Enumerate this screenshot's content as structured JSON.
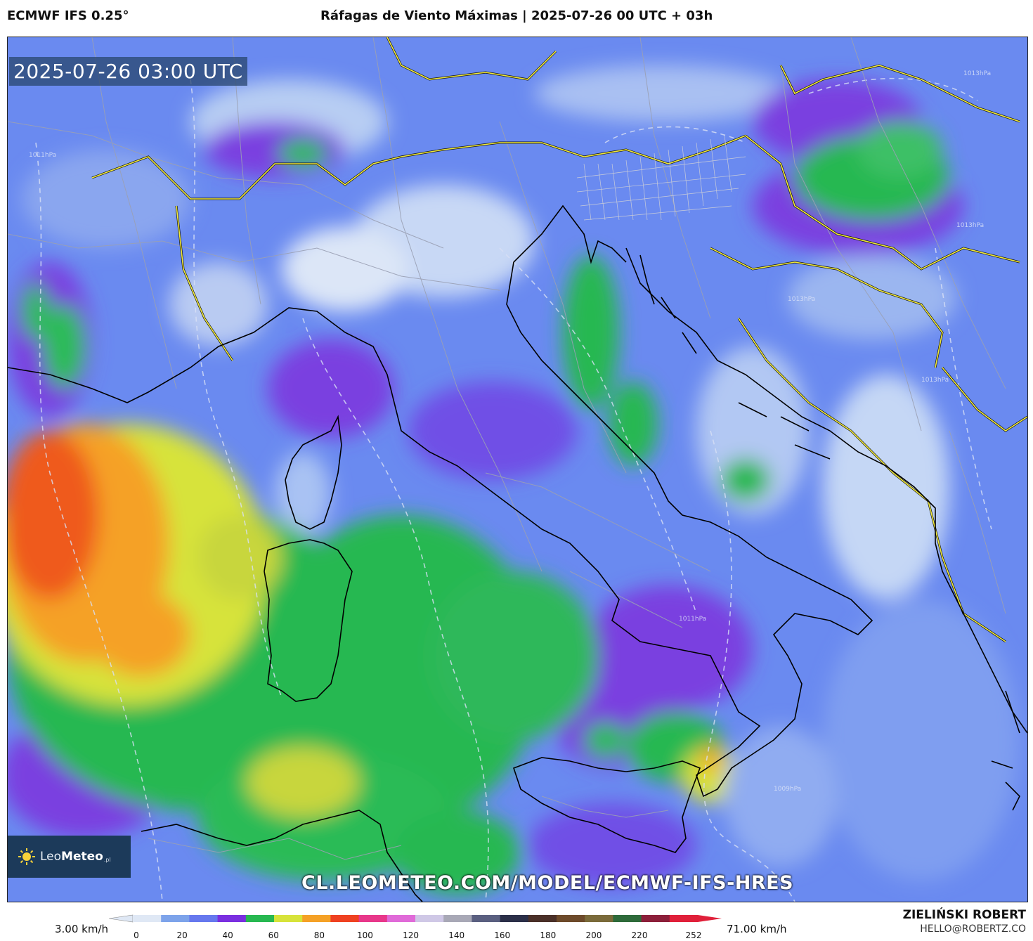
{
  "header": {
    "model": "ECMWF IFS 0.25°",
    "title": "Ráfagas de Viento Máximas | 2025-07-26 00 UTC + 03h"
  },
  "map": {
    "valid_time": "2025-07-26 03:00 UTC",
    "isobar_labels": [
      "1013hPa",
      "1013hPa",
      "1013hPa",
      "1011hPa",
      "1009hPa",
      "1013hPa",
      "1011hPa"
    ]
  },
  "logo": {
    "part1": "Leo",
    "part2": "Meteo",
    "part3": ".pl"
  },
  "url": "CL.LEOMETEO.COM/MODEL/ECMWF-IFS-HRES",
  "colorbar": {
    "min_label": "3.00 km/h",
    "max_label": "71.00 km/h",
    "ticks": [
      "0",
      "20",
      "40",
      "60",
      "80",
      "100",
      "120",
      "140",
      "160",
      "180",
      "200",
      "220",
      "252"
    ],
    "colors": [
      "#dfe8f5",
      "#7da3ea",
      "#6678ee",
      "#7a2fe0",
      "#27b851",
      "#d7e33a",
      "#f5a126",
      "#ef4121",
      "#e8378a",
      "#e06ad8",
      "#cfc8e6",
      "#a8a8b6",
      "#5a5f80",
      "#2b2f48",
      "#4a3028",
      "#6d4a2a",
      "#7a6a3a",
      "#2e6a3a",
      "#8c1f3a",
      "#e0203a"
    ]
  },
  "footer": {
    "author": "ZIELIŃSKI ROBERT",
    "email": "HELLO@ROBERTZ.CO"
  }
}
